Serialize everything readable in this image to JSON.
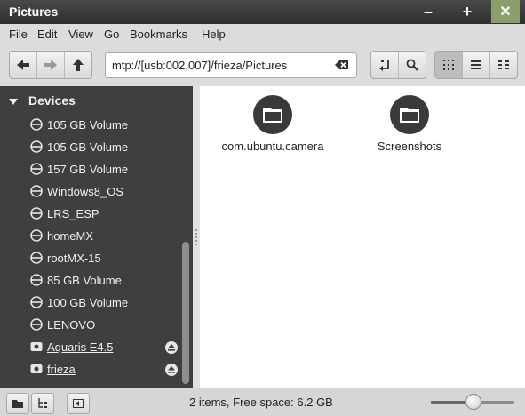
{
  "window": {
    "title": "Pictures",
    "min_label": "–",
    "max_label": "+",
    "close_label": "✕"
  },
  "menu": [
    "File",
    "Edit",
    "View",
    "Go",
    "Bookmarks",
    "Help"
  ],
  "toolbar": {
    "nav_icons": [
      "back-icon",
      "forward-icon",
      "up-icon"
    ],
    "location": "mtp://[usb:002,007]/frieza/Pictures",
    "view_icons": [
      "icon-view-icon",
      "list-view-icon",
      "compact-view-icon"
    ],
    "active_view": 0
  },
  "sidebar": {
    "header": "Devices",
    "items": [
      {
        "label": "105 GB Volume",
        "icon": "drive-icon",
        "eject": false
      },
      {
        "label": "105 GB Volume",
        "icon": "drive-icon",
        "eject": false
      },
      {
        "label": "157 GB Volume",
        "icon": "drive-icon",
        "eject": false
      },
      {
        "label": "Windows8_OS",
        "icon": "drive-icon",
        "eject": false
      },
      {
        "label": "LRS_ESP",
        "icon": "drive-icon",
        "eject": false
      },
      {
        "label": "homeMX",
        "icon": "drive-icon",
        "eject": false
      },
      {
        "label": "rootMX-15",
        "icon": "drive-icon",
        "eject": false
      },
      {
        "label": "85 GB Volume",
        "icon": "drive-icon",
        "eject": false
      },
      {
        "label": "100 GB Volume",
        "icon": "drive-icon",
        "eject": false
      },
      {
        "label": "LENOVO",
        "icon": "drive-icon",
        "eject": false
      },
      {
        "label": "Aquaris E4.5",
        "icon": "phone-icon",
        "eject": true
      },
      {
        "label": "frieza",
        "icon": "phone-icon",
        "eject": true
      }
    ]
  },
  "files": [
    {
      "name": "com.ubuntu.camera",
      "icon": "folder-icon"
    },
    {
      "name": "Screenshots",
      "icon": "folder-icon"
    }
  ],
  "status": {
    "text": "2 items, Free space: 6.2 GB",
    "zoom_fraction": 0.5
  },
  "colors": {
    "sidebar_bg": "#3f3f3f",
    "titlebar_bg": "#3a3a3a",
    "close_btn": "#8b9f6a",
    "folder_icon": "#3a3a3a"
  }
}
